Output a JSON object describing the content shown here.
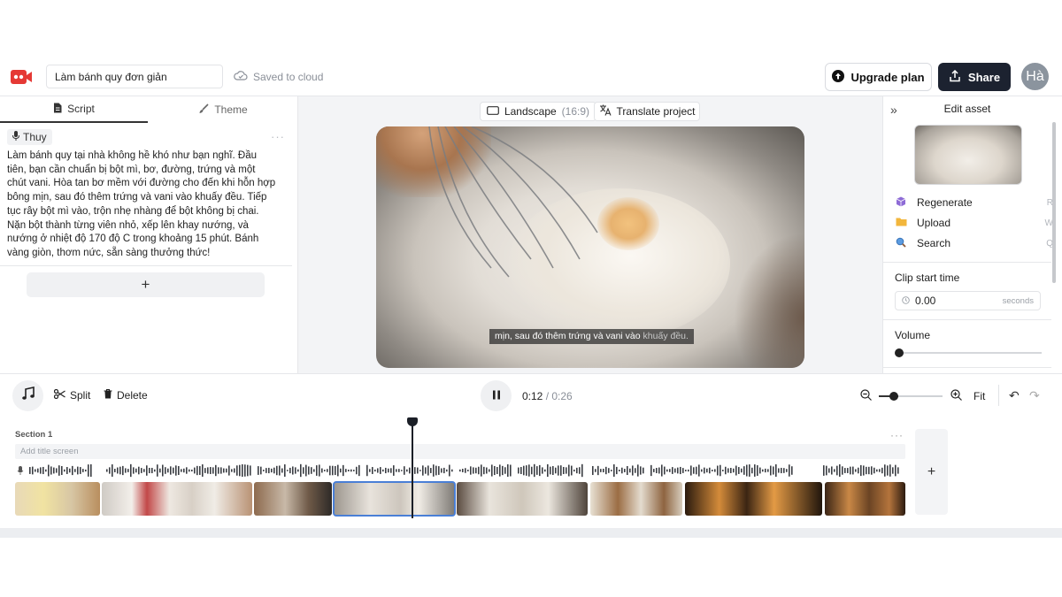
{
  "header": {
    "project_title": "Làm bánh quy đơn giản",
    "saved_status": "Saved to cloud",
    "upgrade_label": "Upgrade plan",
    "share_label": "Share",
    "avatar_initials": "Hà"
  },
  "left_panel": {
    "tabs": [
      {
        "label": "Script",
        "icon": "document-icon",
        "active": true
      },
      {
        "label": "Theme",
        "icon": "brush-icon",
        "active": false
      }
    ],
    "speaker": "Thuy",
    "script_text": "Làm bánh quy tại nhà không hề khó như bạn nghĩ. Đầu tiên, bạn cần chuẩn bị bột mì, bơ, đường, trứng và một chút vani. Hòa tan bơ mềm với đường cho đến khi hỗn hợp bông mịn, sau đó thêm trứng và vani vào khuấy đều. Tiếp tục rây bột mì vào, trộn nhẹ nhàng để bột không bị chai. Nặn bột thành từng viên nhỏ, xếp lên khay nướng, và nướng ở nhiệt độ 170 độ C trong khoảng 15 phút. Bánh vàng giòn, thơm nức, sẵn sàng thưởng thức!",
    "add_label": "+"
  },
  "preview": {
    "aspect_label": "Landscape",
    "aspect_ratio": "(16:9)",
    "translate_label": "Translate project",
    "caption_main": "mịn, sau đó thêm trứng và vani vào",
    "caption_highlight": "khuấy đều."
  },
  "right_panel": {
    "title": "Edit asset",
    "actions": [
      {
        "label": "Regenerate",
        "key": "R",
        "icon": "cube-icon"
      },
      {
        "label": "Upload",
        "key": "W",
        "icon": "folder-icon"
      },
      {
        "label": "Search",
        "key": "Q",
        "icon": "search-icon"
      }
    ],
    "clip_start_label": "Clip start time",
    "clip_start_value": "0.00",
    "clip_start_unit": "seconds",
    "volume_label": "Volume",
    "volume_level": 0
  },
  "toolbar": {
    "split_label": "Split",
    "delete_label": "Delete",
    "current_time": "0:12",
    "total_time": "0:26",
    "fit_label": "Fit"
  },
  "timeline": {
    "section_label": "Section 1",
    "title_placeholder": "Add title screen",
    "add_label": "+",
    "playhead_fraction": 0.46
  }
}
